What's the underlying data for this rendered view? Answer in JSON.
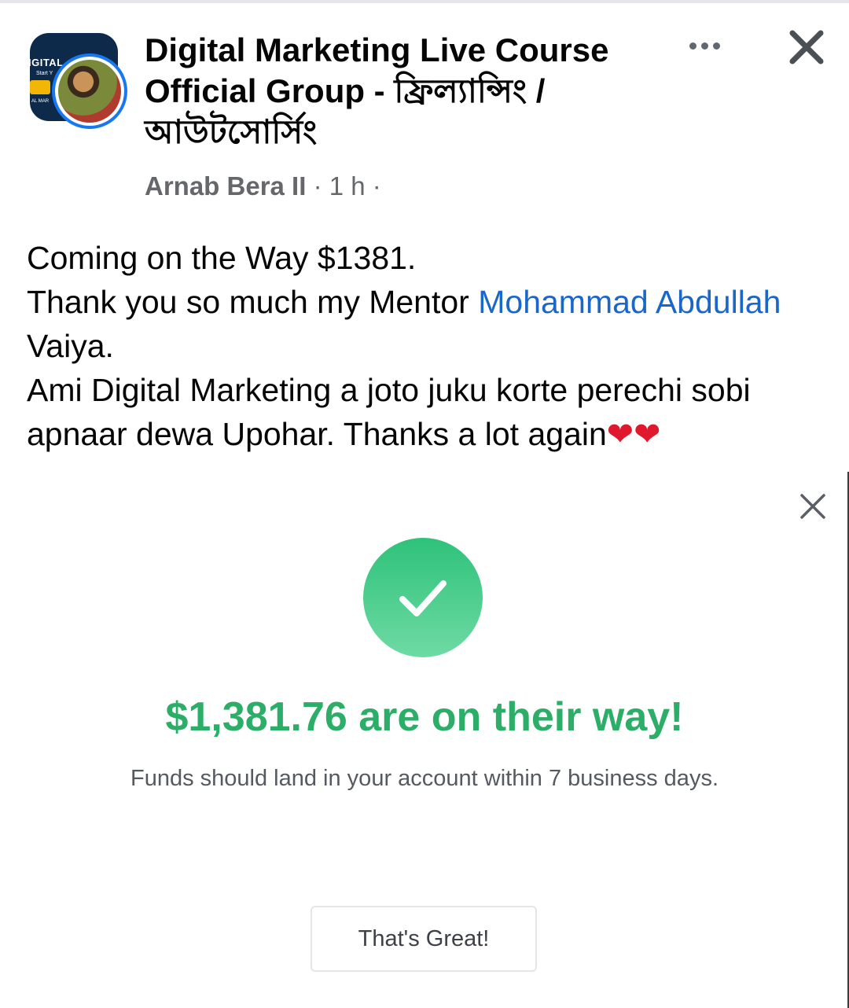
{
  "header": {
    "group_title": "Digital Marketing Live Course Official Group - ফ্রিল্যান্সিং / আউটসোর্সিং",
    "group_logo_text": "IGITAL",
    "group_logo_sub": "Start Y",
    "group_logo_bottom": "AL MAR",
    "author": "Arnab Bera II",
    "time": "1 h"
  },
  "post": {
    "line1": "Coming on the Way $1381.",
    "line2_prefix": "Thank you so much my Mentor ",
    "mention": "Mohammad Abdullah",
    "line2_suffix": " Vaiya.",
    "line3": "Ami Digital Marketing a joto juku korte perechi sobi apnaar dewa Upohar. Thanks a lot again",
    "hearts": "❤❤"
  },
  "shared_image": {
    "amount_title": "$1,381.76 are on their way!",
    "subtitle": "Funds should land in your account within 7 business days.",
    "button_label": "That's Great!"
  },
  "colors": {
    "accent_blue": "#1877f2",
    "mention_blue": "#1b66c9",
    "success_green": "#2dae68"
  }
}
